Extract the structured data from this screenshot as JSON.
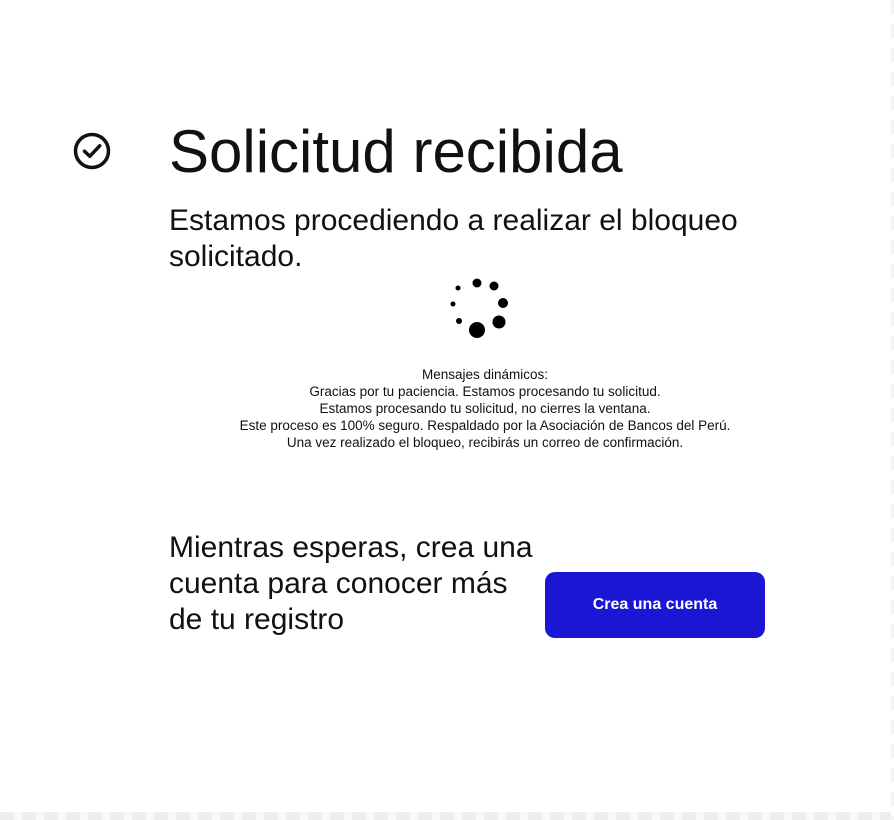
{
  "header": {
    "icon": "check-circle-icon",
    "title": "Solicitud recibida"
  },
  "status": {
    "subtitle": "Estamos procediendo a realizar el bloqueo solicitado.",
    "spinner_icon": "loading-spinner-icon"
  },
  "dynamic_messages": {
    "heading": "Mensajes dinámicos:",
    "items": [
      "Gracias por tu paciencia. Estamos procesando tu solicitud.",
      "Estamos procesando tu solicitud, no cierres la ventana.",
      "Este proceso es 100% seguro. Respaldado por la Asociación de Bancos del Perú.",
      "Una vez realizado el bloqueo, recibirás un correo de confirmación."
    ]
  },
  "promo": {
    "text": "Mientras esperas, crea una cuenta para conocer más de tu registro",
    "button_label": "Crea una cuenta",
    "button_color": "#1A16D3"
  }
}
